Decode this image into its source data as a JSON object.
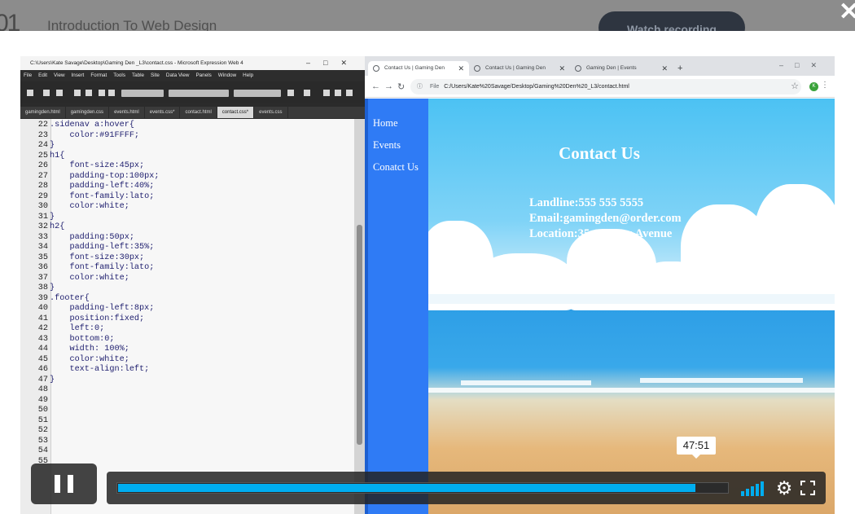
{
  "background_page": {
    "lesson_number": "01",
    "title": "Introduction To Web Design",
    "watch_button": "Watch recording"
  },
  "modal": {
    "close_icon": "close-icon"
  },
  "editor": {
    "window_title": "C:\\Users\\Kate Savage\\Desktop\\Gaming Den _L3\\contact.css - Microsoft Expression Web 4",
    "menu": [
      "File",
      "Edit",
      "View",
      "Insert",
      "Format",
      "Tools",
      "Table",
      "Site",
      "Data View",
      "Panels",
      "Window",
      "Help"
    ],
    "tabs": [
      {
        "label": "gamingden.html",
        "active": false
      },
      {
        "label": "gamingden.css",
        "active": false
      },
      {
        "label": "events.html",
        "active": false
      },
      {
        "label": "events.css*",
        "active": false
      },
      {
        "label": "contact.html",
        "active": false
      },
      {
        "label": "contact.css*",
        "active": true
      },
      {
        "label": "events.css",
        "active": false
      }
    ],
    "code_lines": [
      {
        "n": "22",
        "t": ".sidenav a:hover{"
      },
      {
        "n": "23",
        "t": "    color:#91FFFF;"
      },
      {
        "n": "24",
        "t": "}"
      },
      {
        "n": "25",
        "t": "h1{"
      },
      {
        "n": "26",
        "t": "    font-size:45px;"
      },
      {
        "n": "27",
        "t": "    padding-top:100px;"
      },
      {
        "n": "28",
        "t": "    padding-left:40%;"
      },
      {
        "n": "29",
        "t": "    font-family:lato;"
      },
      {
        "n": "30",
        "t": "    color:white;"
      },
      {
        "n": "31",
        "t": "}"
      },
      {
        "n": "32",
        "t": "h2{"
      },
      {
        "n": "33",
        "t": "    padding:50px;"
      },
      {
        "n": "34",
        "t": "    padding-left:35%;"
      },
      {
        "n": "35",
        "t": "    font-size:30px;"
      },
      {
        "n": "36",
        "t": "    font-family:lato;"
      },
      {
        "n": "37",
        "t": "    color:white;"
      },
      {
        "n": "38",
        "t": "}"
      },
      {
        "n": "39",
        "t": ".footer{"
      },
      {
        "n": "40",
        "t": "    padding-left:8px;"
      },
      {
        "n": "41",
        "t": "    position:fixed;"
      },
      {
        "n": "42",
        "t": "    left:0;"
      },
      {
        "n": "43",
        "t": "    bottom:0;"
      },
      {
        "n": "44",
        "t": "    width: 100%;"
      },
      {
        "n": "45",
        "t": "    color:white;"
      },
      {
        "n": "46",
        "t": "    text-align:left;"
      },
      {
        "n": "47",
        "t": "}"
      },
      {
        "n": "48",
        "t": ""
      },
      {
        "n": "49",
        "t": ""
      },
      {
        "n": "50",
        "t": ""
      },
      {
        "n": "51",
        "t": ""
      },
      {
        "n": "52",
        "t": ""
      },
      {
        "n": "53",
        "t": ""
      },
      {
        "n": "54",
        "t": ""
      },
      {
        "n": "55",
        "t": ""
      }
    ]
  },
  "browser": {
    "tabs": [
      {
        "label": "Contact Us | Gaming Den",
        "active": true
      },
      {
        "label": "Contact Us | Gaming Den",
        "active": false
      },
      {
        "label": "Gaming Den | Events",
        "active": false
      }
    ],
    "new_tab": "+",
    "address_prefix": "File",
    "address": "C:/Users/Kate%20Savage/Desktop/Gaming%20Den%20_L3/contact.html",
    "profile_initial": "K",
    "site": {
      "nav": [
        "Home",
        "Events",
        "Conatct Us"
      ],
      "heading": "Contact Us",
      "info": [
        "Landline:555 555 5555",
        "Email:gamingden@order.com",
        "Location:35 Gamers Avenue"
      ]
    }
  },
  "player": {
    "time_tooltip": "47:51",
    "progress_fraction": 0.948,
    "volume_level_bars": 5,
    "accent": "#00adef",
    "icons": {
      "pause": "pause-icon",
      "volume": "volume-icon",
      "settings": "gear-icon",
      "fullscreen": "fullscreen-icon"
    }
  }
}
